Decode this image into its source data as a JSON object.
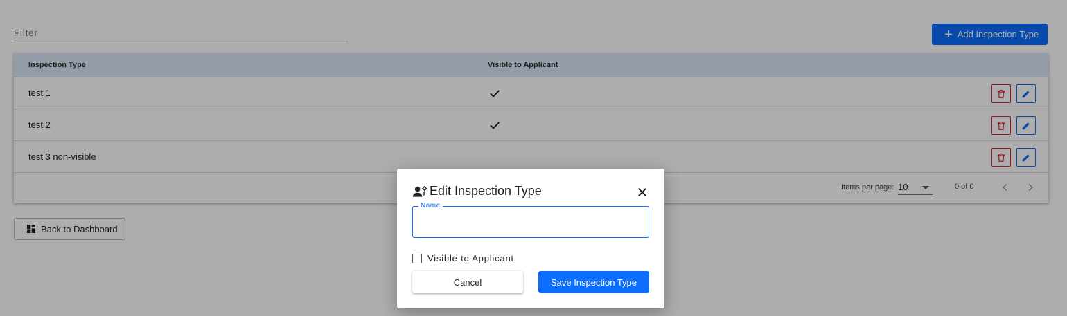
{
  "filter": {
    "label": "Filter"
  },
  "toolbar": {
    "add_label": "Add Inspection Type"
  },
  "table": {
    "headers": [
      "Inspection Type",
      "Visible to Applicant"
    ],
    "rows": [
      {
        "name": "test 1",
        "visible": true
      },
      {
        "name": "test 2",
        "visible": true
      },
      {
        "name": "test 3 non-visible",
        "visible": false
      }
    ]
  },
  "paginator": {
    "items_per_page_label": "Items per page:",
    "items_per_page_value": "10",
    "range_label": "0 of 0"
  },
  "back_button": {
    "label": "Back to Dashboard"
  },
  "dialog": {
    "title": "Edit Inspection Type",
    "name_label": "Name",
    "name_value": "",
    "checkbox_label": "Visible to Applicant",
    "checkbox_checked": false,
    "cancel_label": "Cancel",
    "save_label": "Save Inspection Type"
  },
  "colors": {
    "primary": "#0d6efd",
    "danger": "#d9262e",
    "header_bg": "#dbe8f8"
  }
}
